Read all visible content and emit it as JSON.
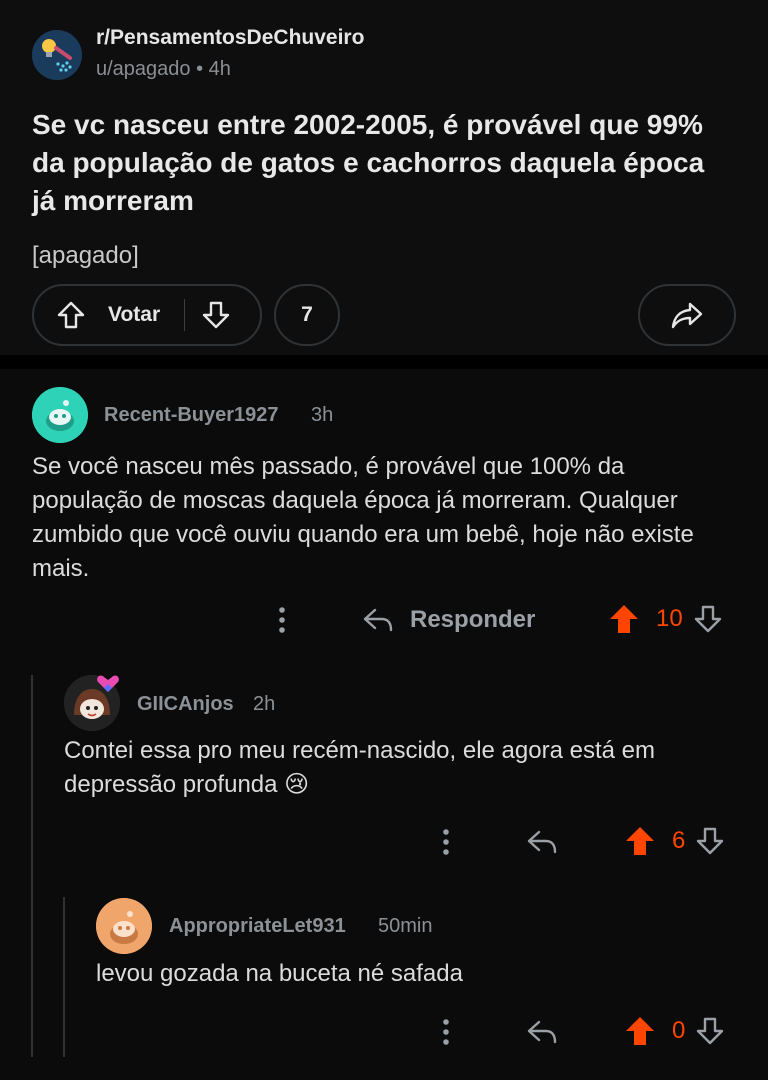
{
  "post": {
    "subreddit": "r/PensamentosDeChuveiro",
    "author_meta": "u/apagado • 4h",
    "title": "Se vc nasceu entre 2002-2005, é provável que 99% da população de gatos e cachorros daquela época já morreram",
    "body": "[apagado]",
    "vote_label": "Votar",
    "comment_count": "7"
  },
  "comments": [
    {
      "username": "Recent-Buyer1927",
      "time": "3h",
      "text": "Se você nasceu mês passado, é provável que 100% da população de moscas daquela época já morreram. Qualquer zumbido que você ouviu quando era um bebê, hoje não existe mais.",
      "reply_label": "Responder",
      "score": "10"
    },
    {
      "username": "GIICAnjos",
      "time": "2h",
      "text": "Contei essa pro meu recém-nascido, ele agora está em depressão profunda 😢",
      "score": "6"
    },
    {
      "username": "AppropriateLet931",
      "time": "50min",
      "text": "levou gozada na buceta né safada",
      "score": "0"
    }
  ],
  "colors": {
    "upvote_active": "#ff4500",
    "muted": "#8b9196",
    "background": "#0b0b0b"
  },
  "icons": [
    "shower-icon",
    "upvote-icon",
    "downvote-icon",
    "share-icon",
    "more-icon",
    "reply-icon",
    "avatar-snoo-icon"
  ]
}
